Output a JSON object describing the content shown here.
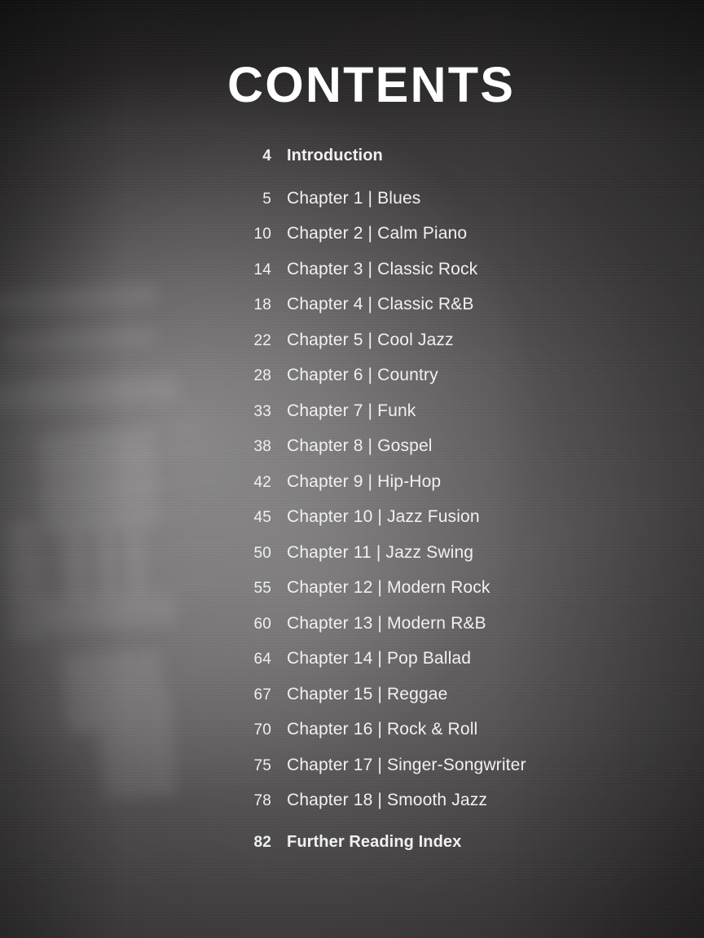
{
  "document": {
    "title": "CONTENTS",
    "background_color": "#4a4749",
    "text_color": "#f2f1f1",
    "highlight_color": "#757274"
  },
  "toc": {
    "entries": [
      {
        "page": "4",
        "label": "Introduction",
        "emphasis": "bold",
        "spaced_after": true
      },
      {
        "page": "5",
        "label": "Chapter 1 | Blues",
        "emphasis": "normal",
        "spaced_after": false
      },
      {
        "page": "10",
        "label": "Chapter 2 | Calm Piano",
        "emphasis": "normal",
        "spaced_after": false
      },
      {
        "page": "14",
        "label": "Chapter 3 | Classic Rock",
        "emphasis": "normal",
        "spaced_after": false
      },
      {
        "page": "18",
        "label": "Chapter 4 | Classic R&B",
        "emphasis": "normal",
        "spaced_after": false
      },
      {
        "page": "22",
        "label": "Chapter 5 | Cool Jazz",
        "emphasis": "normal",
        "spaced_after": false
      },
      {
        "page": "28",
        "label": "Chapter 6 | Country",
        "emphasis": "normal",
        "spaced_after": false
      },
      {
        "page": "33",
        "label": "Chapter 7 | Funk",
        "emphasis": "normal",
        "spaced_after": false
      },
      {
        "page": "38",
        "label": "Chapter 8 | Gospel",
        "emphasis": "normal",
        "spaced_after": false
      },
      {
        "page": "42",
        "label": "Chapter 9 | Hip-Hop",
        "emphasis": "normal",
        "spaced_after": false
      },
      {
        "page": "45",
        "label": "Chapter 10 | Jazz Fusion",
        "emphasis": "normal",
        "spaced_after": false
      },
      {
        "page": "50",
        "label": "Chapter 11 | Jazz Swing",
        "emphasis": "normal",
        "spaced_after": false
      },
      {
        "page": "55",
        "label": "Chapter 12 | Modern Rock",
        "emphasis": "normal",
        "spaced_after": false
      },
      {
        "page": "60",
        "label": "Chapter 13 | Modern R&B",
        "emphasis": "normal",
        "spaced_after": false
      },
      {
        "page": "64",
        "label": "Chapter 14 | Pop Ballad",
        "emphasis": "normal",
        "spaced_after": false
      },
      {
        "page": "67",
        "label": "Chapter 15 | Reggae",
        "emphasis": "normal",
        "spaced_after": false
      },
      {
        "page": "70",
        "label": "Chapter 16 | Rock & Roll",
        "emphasis": "normal",
        "spaced_after": false
      },
      {
        "page": "75",
        "label": "Chapter 17 | Singer-Songwriter",
        "emphasis": "normal",
        "spaced_after": false
      },
      {
        "page": "78",
        "label": "Chapter 18 | Smooth Jazz",
        "emphasis": "normal",
        "spaced_after": true
      },
      {
        "page": "82",
        "label": "Further Reading Index",
        "emphasis": "bold",
        "spaced_after": false
      }
    ]
  }
}
